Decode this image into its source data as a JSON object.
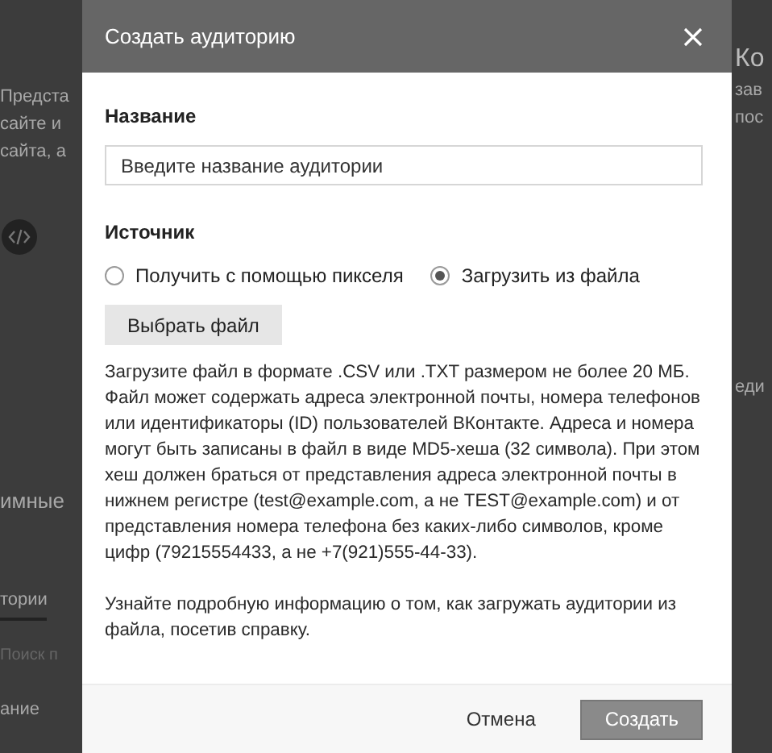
{
  "background": {
    "left_items": [
      {
        "kind": "text",
        "text": "Предста"
      },
      {
        "kind": "text",
        "text": "сайте и"
      },
      {
        "kind": "text",
        "text": "сайта, а"
      },
      {
        "kind": "icon"
      },
      {
        "kind": "heading",
        "text": "имные"
      },
      {
        "kind": "tab",
        "text": "тории",
        "selected": true
      },
      {
        "kind": "search",
        "placeholder": "Поиск п"
      },
      {
        "kind": "text",
        "text": "ание"
      }
    ],
    "right_items": [
      {
        "kind": "heading",
        "text": "Ко"
      },
      {
        "kind": "text",
        "text": "зав"
      },
      {
        "kind": "text",
        "text": "пос"
      },
      {
        "kind": "text",
        "text": "еди"
      }
    ]
  },
  "dialog": {
    "title": "Создать аудиторию",
    "name_label": "Название",
    "name_field": {
      "placeholder": "Введите название аудитории"
    },
    "source_label": "Источник",
    "source_options": [
      {
        "label": "Получить с помощью пикселя",
        "selected": false
      },
      {
        "label": "Загрузить из файла",
        "selected": true
      }
    ],
    "file_button": "Выбрать файл",
    "description": [
      "Загрузите файл в формате .CSV или .TXT размером не более 20 МБ. Файл может содержать адреса электронной почты, номера телефонов или идентификаторы (ID) пользователей ВКонтакте. Адреса и номера могут быть записаны в файл в виде MD5-хеша (32 символа). При этом хеш должен браться от представления адреса электронной почты в нижнем регистре (test@example.com, а не TEST@example.com) и от представления номера телефона без каких-либо символов, кроме цифр (79215554433, а не +7(921)555-44-33).",
      "Узнайте подробную информацию о том, как загружать аудитории из файла, посетив справку."
    ],
    "buttons": [
      {
        "label": "Отмена",
        "kind": "secondary"
      },
      {
        "label": "Создать",
        "kind": "primary"
      }
    ]
  }
}
